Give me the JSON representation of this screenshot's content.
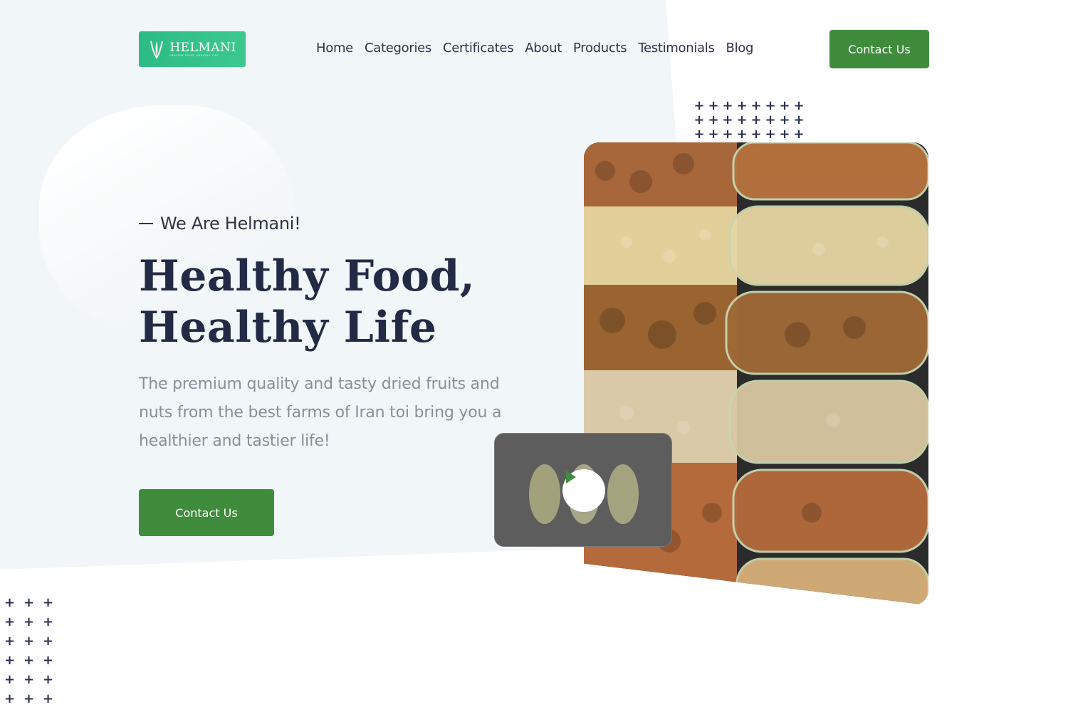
{
  "brand": {
    "name": "HELMANI",
    "tagline": "HEALTHY FOOD, HEALTHY LIFE",
    "logo_color": "#2dbb85"
  },
  "nav": {
    "items": [
      "Home",
      "Categories",
      "Certificates",
      "About",
      "Products",
      "Testimonials",
      "Blog"
    ]
  },
  "header": {
    "contact_label": "Contact Us"
  },
  "hero": {
    "eyebrow": "We Are Helmani!",
    "headline_line1": "Healthy Food,",
    "headline_line2": "Healthy Life",
    "description": "The premium quality and tasty dried fruits and nuts from the best farms of Iran toi bring you a healthier and tastier life!",
    "cta_label": "Contact Us",
    "image_subject": "nuts-in-glass-tubes",
    "video_thumbnail_subject": "pistachios",
    "play_icon": "play-icon"
  },
  "colors": {
    "accent_green": "#3f8c3d",
    "heading_navy": "#222a45",
    "body_gray": "#8a8e9a",
    "hero_bg": "#f1f6f8"
  }
}
